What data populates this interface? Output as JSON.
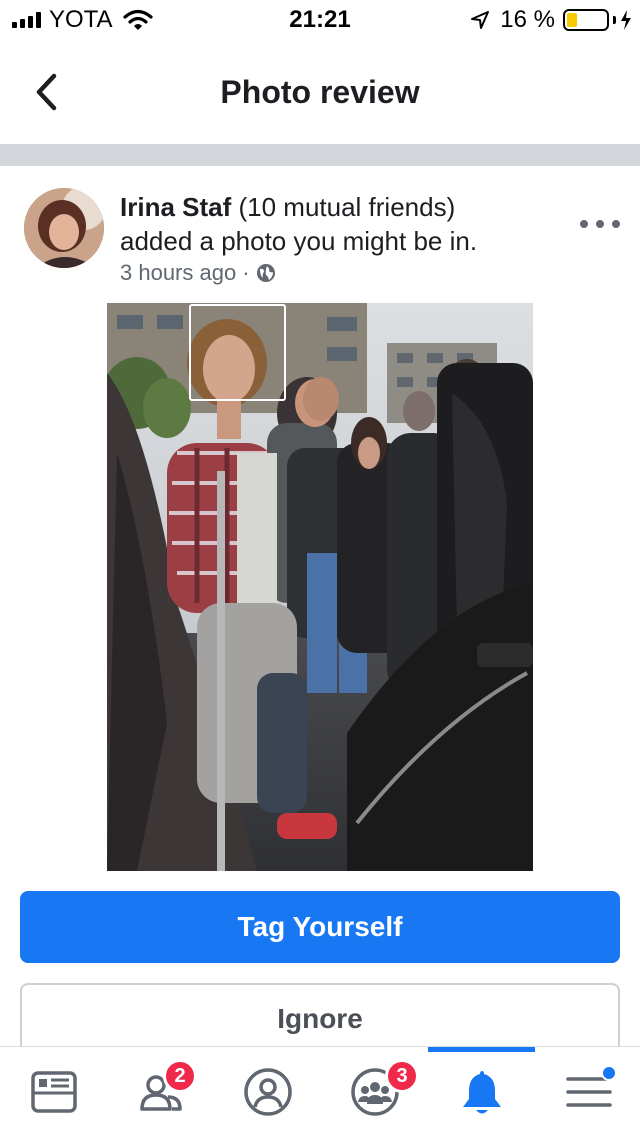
{
  "status_bar": {
    "carrier": "YOTA",
    "time": "21:21",
    "battery_percent": "16 %",
    "battery_level": 0.16,
    "icons": [
      "signal-icon",
      "wifi-icon",
      "location-arrow-icon",
      "battery-icon",
      "charging-bolt-icon"
    ]
  },
  "header": {
    "title": "Photo review",
    "back_icon": "chevron-left-icon"
  },
  "post": {
    "author": "Irina  Staf",
    "mutual": "(10 mutual friends)",
    "action": "added a photo you might be in.",
    "time": "3 hours ago",
    "separator": "·",
    "privacy_icon": "globe-icon",
    "more_icon": "more-dots-icon"
  },
  "actions": {
    "tag_label": "Tag Yourself",
    "ignore_label": "Ignore"
  },
  "tab_bar": {
    "tabs": [
      {
        "name": "news-feed",
        "icon": "news-feed-icon"
      },
      {
        "name": "friends",
        "icon": "friends-icon",
        "badge": "2"
      },
      {
        "name": "profile",
        "icon": "profile-icon"
      },
      {
        "name": "groups",
        "icon": "groups-icon",
        "badge": "3"
      },
      {
        "name": "notifications",
        "icon": "bell-icon",
        "active": true
      },
      {
        "name": "menu",
        "icon": "menu-icon",
        "dot": true
      }
    ]
  },
  "colors": {
    "accent": "#1877f2",
    "badge": "#f02849",
    "divider": "#d3d6db",
    "battery": "#f7c900"
  }
}
